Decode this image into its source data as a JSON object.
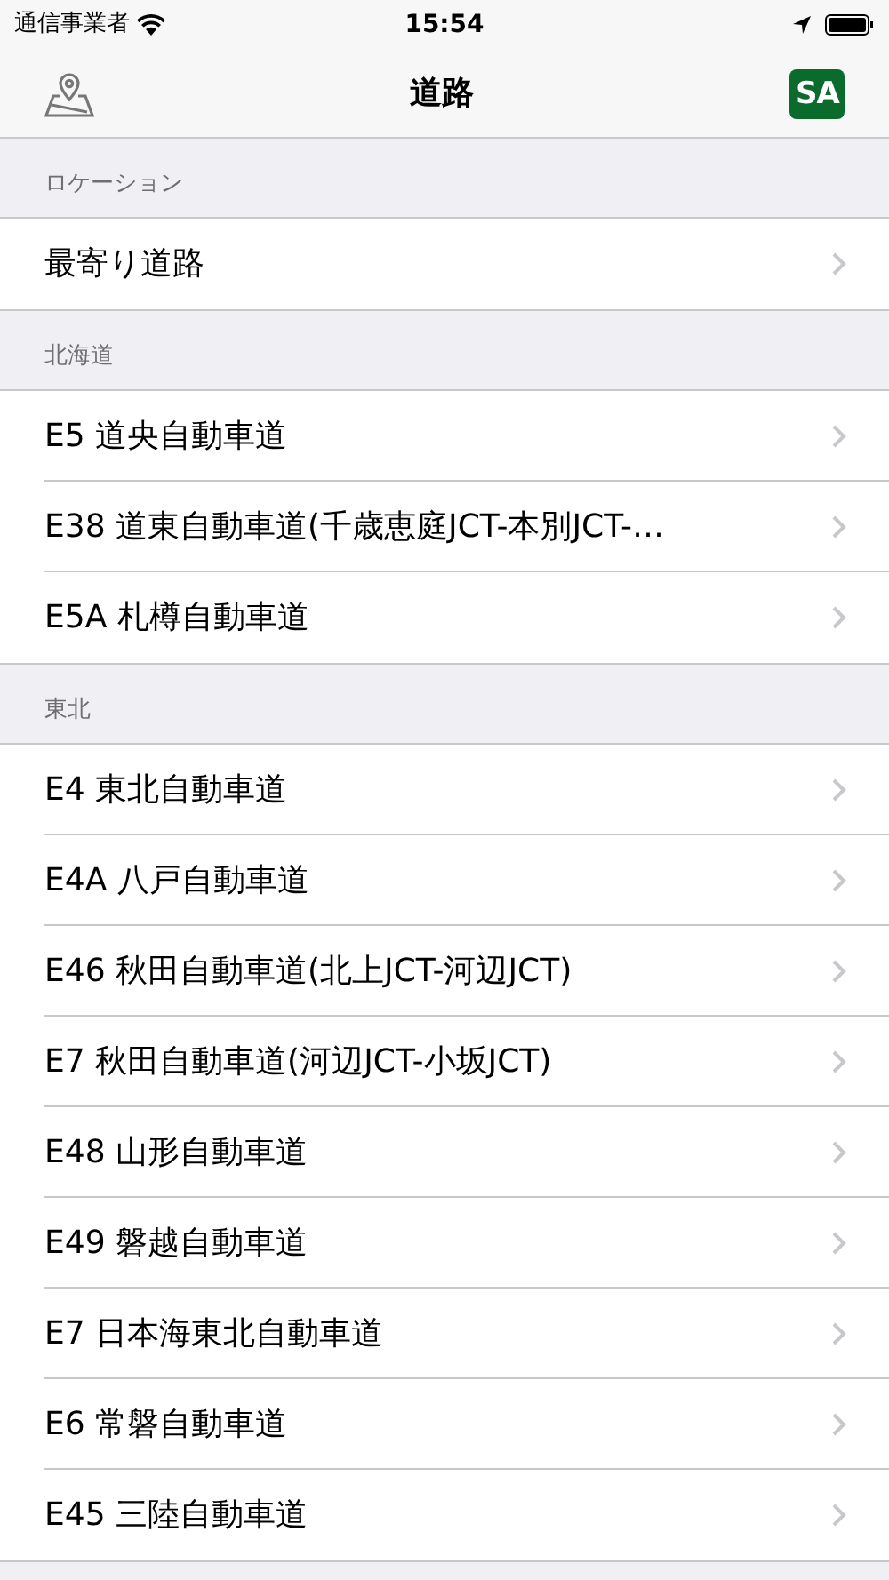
{
  "status_bar": {
    "carrier": "通信事業者",
    "time": "15:54"
  },
  "nav_bar": {
    "title": "道路",
    "sa_badge": "SA"
  },
  "sections": [
    {
      "header": "ロケーション",
      "rows": [
        "最寄り道路"
      ]
    },
    {
      "header": "北海道",
      "rows": [
        "E5 道央自動車道",
        "E38 道東自動車道(千歳恵庭JCT-本別JCT-…",
        "E5A 札樽自動車道"
      ]
    },
    {
      "header": "東北",
      "rows": [
        "E4 東北自動車道",
        "E4A 八戸自動車道",
        "E46 秋田自動車道(北上JCT-河辺JCT)",
        "E7 秋田自動車道(河辺JCT-小坂JCT)",
        "E48 山形自動車道",
        "E49 磐越自動車道",
        "E7 日本海東北自動車道",
        "E6 常磐自動車道",
        "E45 三陸自動車道"
      ]
    }
  ]
}
